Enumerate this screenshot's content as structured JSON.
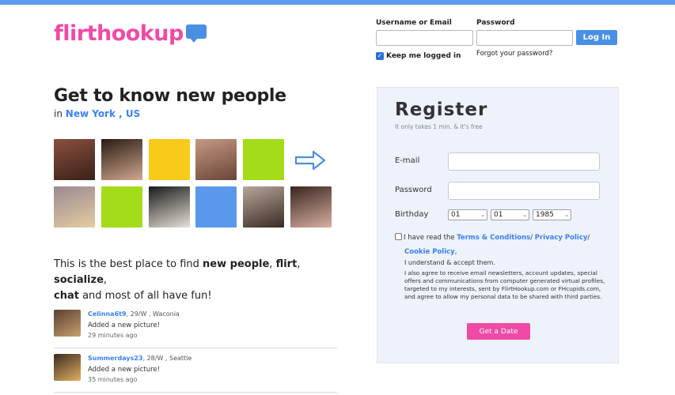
{
  "brand": {
    "logo_text": "flirthookup",
    "logo_color": "#f04aa6",
    "bubble_color": "#4a8fe6"
  },
  "login": {
    "username_label": "Username or Email",
    "password_label": "Password",
    "login_button": "Log In",
    "keep_logged_in": "Keep me logged in",
    "keep_logged_in_checked": true,
    "forgot_password": "Forgot your password?"
  },
  "hero": {
    "headline": "Get to know new people",
    "location_prefix": "in",
    "location": "New York , US"
  },
  "photo_grid": [
    {
      "type": "photo",
      "colors": [
        "#8a5040",
        "#3a2018"
      ]
    },
    {
      "type": "photo",
      "colors": [
        "#2a1a12",
        "#d0a890"
      ]
    },
    {
      "type": "placeholder",
      "colors": [
        "#f8cb1a",
        "#f8cb1a"
      ]
    },
    {
      "type": "photo",
      "colors": [
        "#c59a84",
        "#6a4436"
      ]
    },
    {
      "type": "placeholder",
      "colors": [
        "#a4dc1a",
        "#a4dc1a"
      ]
    },
    {
      "type": "photo",
      "colors": [
        "#9a8a92",
        "#e6cba0"
      ]
    },
    {
      "type": "placeholder",
      "colors": [
        "#a4dc1a",
        "#a4dc1a"
      ]
    },
    {
      "type": "photo",
      "colors": [
        "#1a1a1a",
        "#e8e0d8"
      ]
    },
    {
      "type": "placeholder",
      "colors": [
        "#5a98ec",
        "#5a98ec"
      ]
    },
    {
      "type": "photo",
      "colors": [
        "#b8a69a",
        "#3a2a24"
      ]
    },
    {
      "type": "photo",
      "colors": [
        "#3a2420",
        "#d8b0a0"
      ]
    }
  ],
  "arrow_icon": "arrow-right-icon",
  "tagline": {
    "p1": "This is the best place to find ",
    "b1": "new people",
    "p2": ", ",
    "b2": "flirt",
    "p3": ", ",
    "b3": "socialize",
    "p4": ",",
    "b4": "chat",
    "p5": " and most of all have fun!"
  },
  "activity": [
    {
      "username": "Celinna6t9",
      "details": ", 29/W , Waconia",
      "action": "Added a new picture!",
      "time": "29 minutes ago"
    },
    {
      "username": "Summerdays23",
      "details": ", 28/W , Seattle",
      "action": "Added a new picture!",
      "time": "35 minutes ago"
    }
  ],
  "register": {
    "title": "Register",
    "subtitle": "It only takes 1 min. & it's free",
    "email_label": "E-mail",
    "password_label": "Password",
    "birthday_label": "Birthday",
    "birthday_day": "01",
    "birthday_month": "01",
    "birthday_year": "1985",
    "terms_prefix": "I have read the ",
    "terms_link": "Terms & Conditions",
    "sep1": "/ ",
    "privacy_link": "Privacy Policy",
    "sep2": "/",
    "cookie_link": "Cookie Policy",
    "sep3": ",",
    "understand": "I understand & accept them.",
    "agree_text": "I also agree to receive email newsletters, account updates, special offers and communications from computer generated virtual profiles, targeted to my interests, sent by FlirtHookup.com or FHcupids.com, and agree to allow my personal data to be shared with third parties.",
    "submit_button": "Get a Date",
    "accent_color": "#f04aa6"
  }
}
